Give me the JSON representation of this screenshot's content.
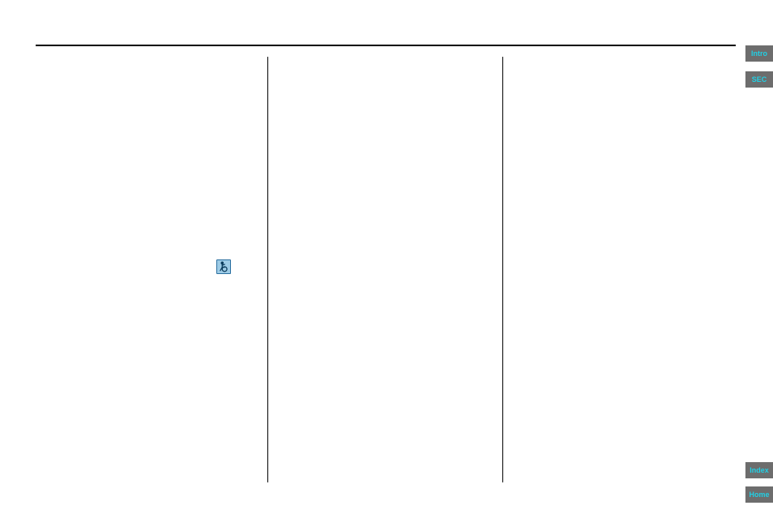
{
  "nav": {
    "intro": "Intro",
    "sec": "SEC",
    "index": "Index",
    "home": "Home"
  },
  "icon": {
    "semantic": "accessibility-icon"
  }
}
